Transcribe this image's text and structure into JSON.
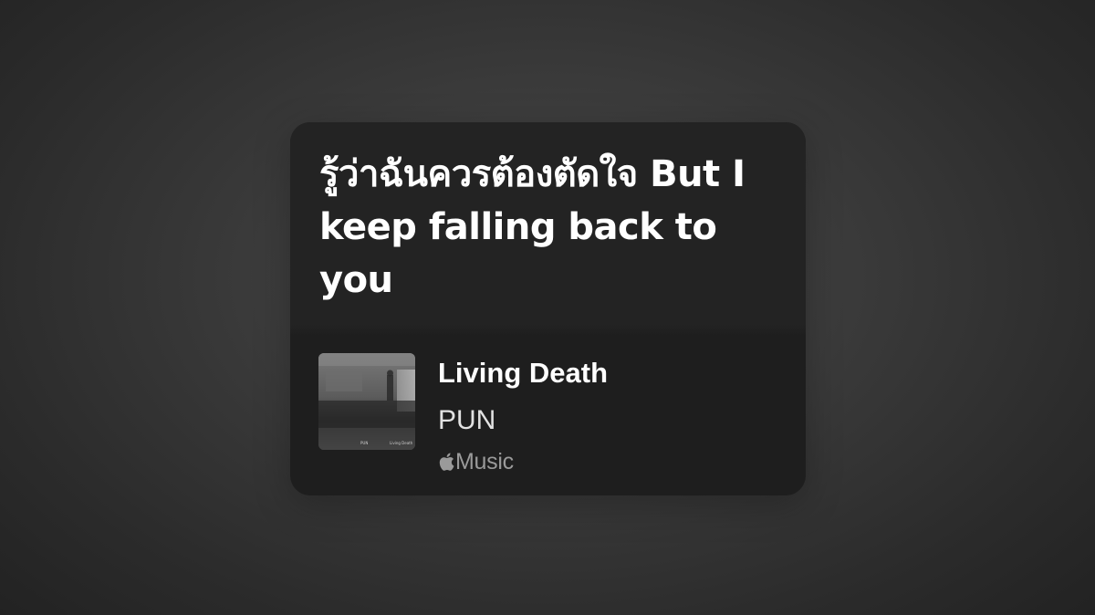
{
  "lyric_card": {
    "lyrics": "รู้ว่าฉันควรต้องตัดใจ But I keep falling back to you",
    "song_title": "Living Death",
    "artist": "PUN",
    "source_brand_icon": "apple-logo-icon",
    "source_label": "Music",
    "album_art_caption_left": "PUN",
    "album_art_caption_right": "Living Death"
  },
  "colors": {
    "card_background": "#1e1e1e",
    "lyrics_background": "#232323",
    "text_primary": "#ffffff",
    "text_secondary": "#e2e2e2",
    "text_muted": "#9a9a9a"
  }
}
